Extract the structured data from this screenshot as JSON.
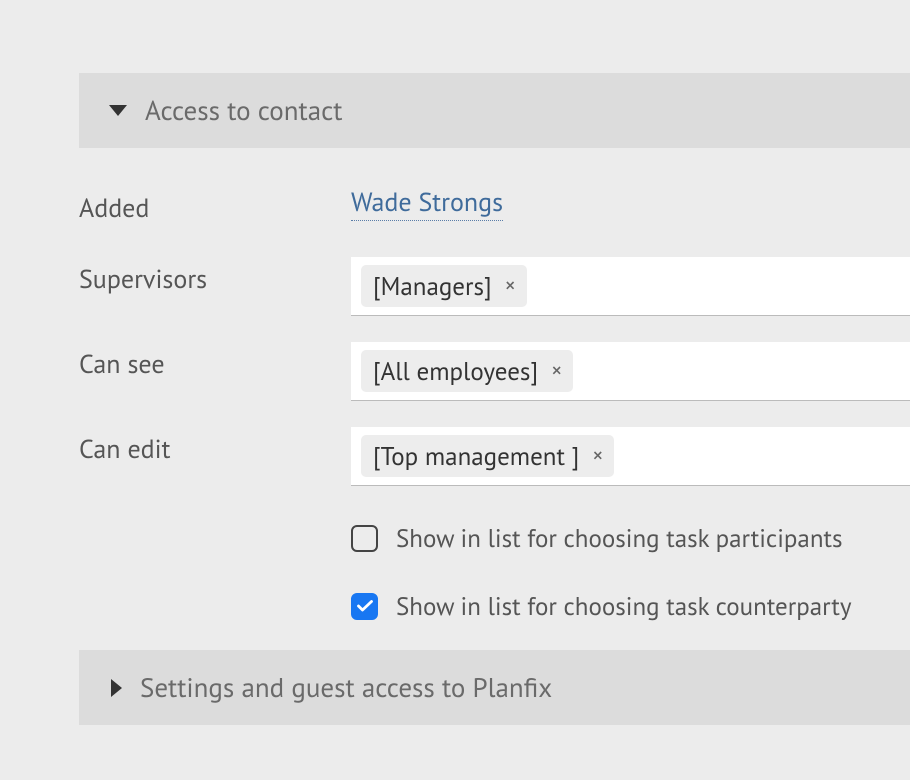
{
  "sections": {
    "accessToContact": {
      "title": "Access to contact",
      "expanded": true
    },
    "guestAccess": {
      "title": "Settings and guest access to Planfix",
      "expanded": false
    }
  },
  "fields": {
    "added": {
      "label": "Added",
      "value": "Wade Strongs"
    },
    "supervisors": {
      "label": "Supervisors",
      "tags": [
        "[Managers]"
      ]
    },
    "canSee": {
      "label": "Can see",
      "tags": [
        "[All employees]"
      ]
    },
    "canEdit": {
      "label": "Can edit",
      "tags": [
        "[Top management ]"
      ]
    }
  },
  "checkboxes": {
    "participants": {
      "label": "Show in list for choosing task participants",
      "checked": false
    },
    "counterparty": {
      "label": "Show in list for choosing task counterparty",
      "checked": true
    }
  }
}
